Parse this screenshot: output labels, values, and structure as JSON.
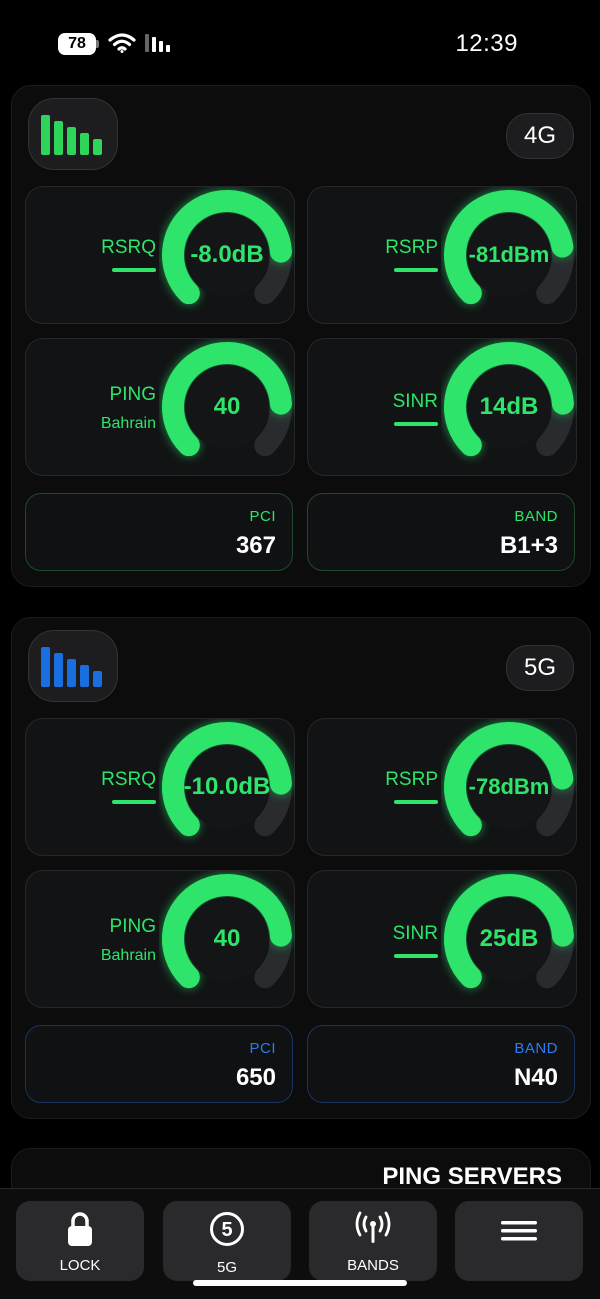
{
  "status_bar": {
    "battery": "78",
    "time": "12:39"
  },
  "panels": [
    {
      "technology": "4G",
      "signal_color": "#2fd45a",
      "accent": "#2ee46a",
      "rsrq": {
        "label": "RSRQ",
        "value": "-8.0dB",
        "level": 0.82
      },
      "rsrp": {
        "label": "RSRP",
        "value": "-81dBm",
        "level": 0.8
      },
      "ping": {
        "label": "PING",
        "sub": "Bahrain",
        "value": "40",
        "level": 0.82
      },
      "sinr": {
        "label": "SINR",
        "value": "14dB",
        "level": 0.82
      },
      "pci": {
        "label": "PCI",
        "value": "367"
      },
      "band": {
        "label": "BAND",
        "value": "B1+3"
      },
      "info_label_color": "#2ee46a",
      "info_border": "#1e4a2b"
    },
    {
      "technology": "5G",
      "signal_color": "#1a6fe0",
      "accent": "#2ee46a",
      "rsrq": {
        "label": "RSRQ",
        "value": "-10.0dB",
        "level": 0.82
      },
      "rsrp": {
        "label": "RSRP",
        "value": "-78dBm",
        "level": 0.8
      },
      "ping": {
        "label": "PING",
        "sub": "Bahrain",
        "value": "40",
        "level": 0.82
      },
      "sinr": {
        "label": "SINR",
        "value": "25dB",
        "level": 0.82
      },
      "pci": {
        "label": "PCI",
        "value": "650"
      },
      "band": {
        "label": "BAND",
        "value": "N40"
      },
      "info_label_color": "#2a7cf0",
      "info_border": "#1c3260"
    }
  ],
  "ping_servers": {
    "title": "PING SERVERS"
  },
  "nav": {
    "lock": "LOCK",
    "fiveg": "5G",
    "fiveg_glyph": "5",
    "bands": "BANDS",
    "menu_icon": "hamburger-menu-icon"
  }
}
